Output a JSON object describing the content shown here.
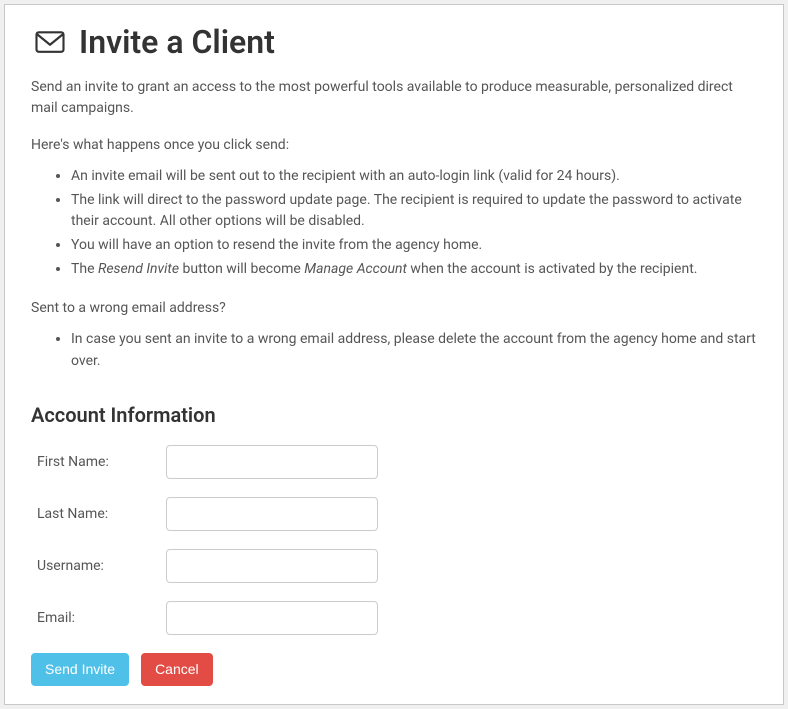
{
  "header": {
    "title": "Invite a Client"
  },
  "intro": "Send an invite to grant an access to the most powerful tools available to produce measurable, personalized direct mail campaigns.",
  "subhead1": "Here's what happens once you click send:",
  "list1": {
    "item1": "An invite email will be sent out to the recipient with an auto-login link (valid for 24 hours).",
    "item2": "The link will direct to the password update page. The recipient is required to update the password to activate their account. All other options will be disabled.",
    "item3": "You will have an option to resend the invite from the agency home.",
    "item4_prefix": "The ",
    "item4_italic1": "Resend Invite",
    "item4_mid": " button will become ",
    "item4_italic2": "Manage Account",
    "item4_suffix": " when the account is activated by the recipient."
  },
  "subhead2": "Sent to a wrong email address?",
  "list2": {
    "item1": "In case you sent an invite to a wrong email address, please delete the account from the agency home and start over."
  },
  "form": {
    "section_title": "Account Information",
    "first_name_label": "First Name:",
    "last_name_label": "Last Name:",
    "username_label": "Username:",
    "email_label": "Email:",
    "first_name_value": "",
    "last_name_value": "",
    "username_value": "",
    "email_value": ""
  },
  "buttons": {
    "send_label": "Send Invite",
    "cancel_label": "Cancel"
  }
}
